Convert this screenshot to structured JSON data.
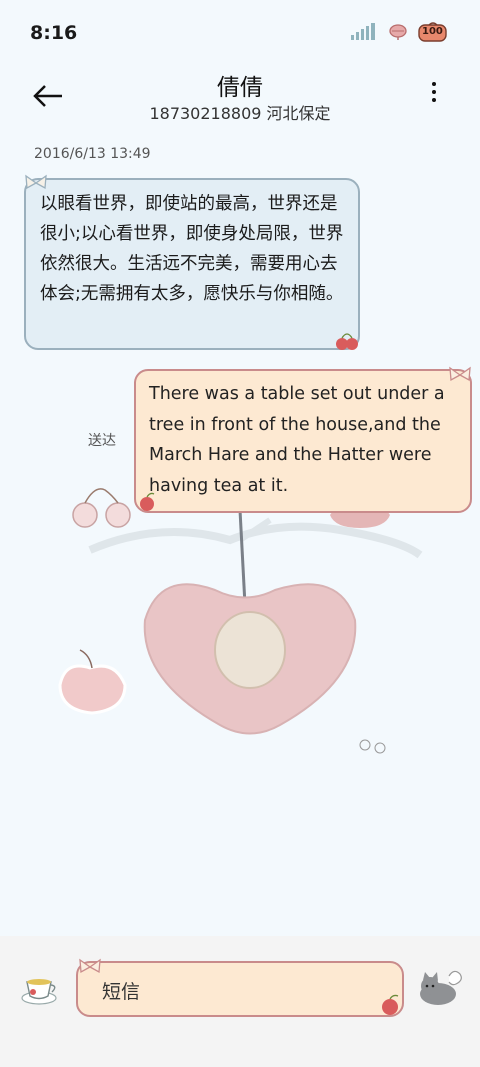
{
  "status": {
    "time": "8:16",
    "battery": "100"
  },
  "header": {
    "contact_name": "倩倩",
    "contact_sub": "18730218809 河北保定"
  },
  "conversation": {
    "timestamp": "2016/6/13 13:49",
    "incoming_message": "以眼看世界，即使站的最高，世界还是很小;以心看世界，即使身处局限，世界依然很大。生活远不完美，需要用心去体会;无需拥有太多，愿快乐与你相随。",
    "outgoing_message": "There was a table set out under a tree in front of the house,and the March Hare and the Hatter were having tea at it.",
    "outgoing_status": "送达"
  },
  "composer": {
    "placeholder": "短信"
  },
  "colors": {
    "incoming_bg": "#e3eef5",
    "incoming_border": "#9bb0bd",
    "outgoing_bg": "#fde9d2",
    "outgoing_border": "#c98b8b",
    "page_bg": "#f3f9fd"
  }
}
